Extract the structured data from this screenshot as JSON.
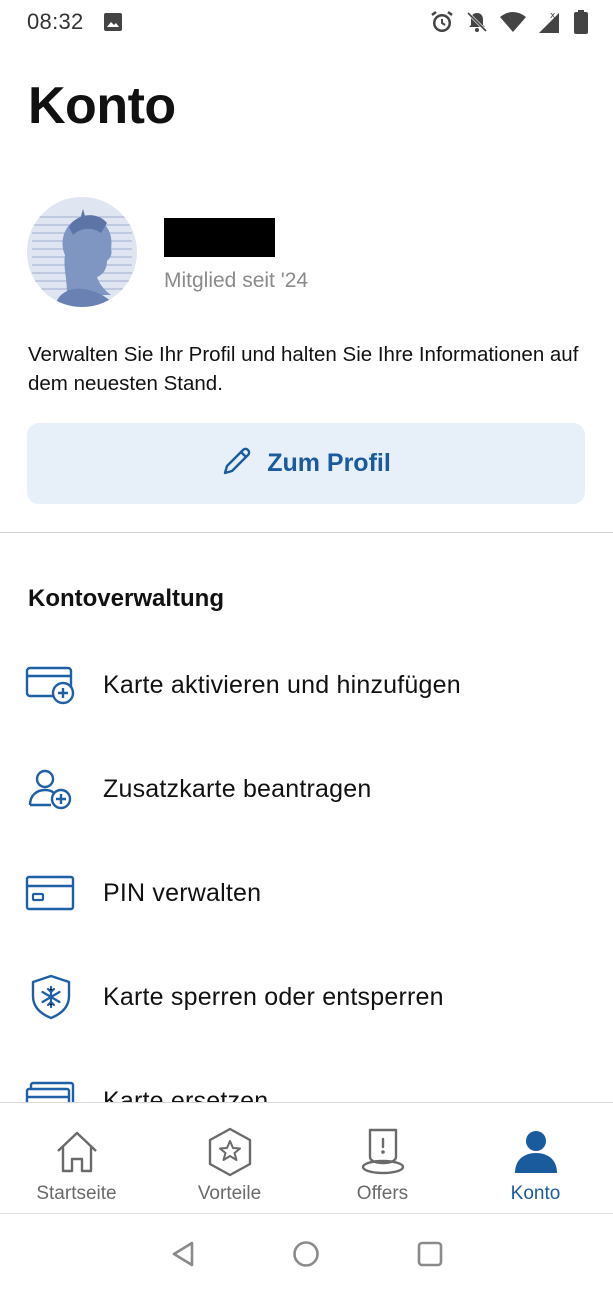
{
  "status_bar": {
    "time": "08:32",
    "icons": [
      "image-icon",
      "alarm-icon",
      "notifications-off-icon",
      "wifi-icon",
      "signal-icon",
      "battery-icon"
    ]
  },
  "page": {
    "title": "Konto"
  },
  "profile": {
    "member_since": "Mitglied seit '24",
    "description": "Verwalten Sie Ihr Profil und halten Sie Ihre Informationen auf dem neuesten Stand.",
    "button_label": "Zum Profil",
    "button_icon": "pencil-icon"
  },
  "account_management": {
    "section_title": "Kontoverwaltung",
    "items": [
      {
        "label": "Karte aktivieren und hinzufügen",
        "icon": "card-add-icon"
      },
      {
        "label": "Zusatzkarte beantragen",
        "icon": "user-add-icon"
      },
      {
        "label": "PIN verwalten",
        "icon": "card-icon"
      },
      {
        "label": "Karte sperren oder entsperren",
        "icon": "shield-snowflake-icon"
      },
      {
        "label": "Karte ersetzen",
        "icon": "card-replace-icon"
      }
    ]
  },
  "bottom_nav": {
    "tabs": [
      {
        "label": "Startseite",
        "icon": "home-icon",
        "active": false
      },
      {
        "label": "Vorteile",
        "icon": "star-badge-icon",
        "active": false
      },
      {
        "label": "Offers",
        "icon": "offer-tag-icon",
        "active": false
      },
      {
        "label": "Konto",
        "icon": "person-icon",
        "active": true
      }
    ]
  },
  "colors": {
    "accent": "#1a5b9e",
    "button_bg": "#e7f0f9",
    "icon_blue": "#1f5fa6",
    "muted_text": "#8a8a8a"
  }
}
